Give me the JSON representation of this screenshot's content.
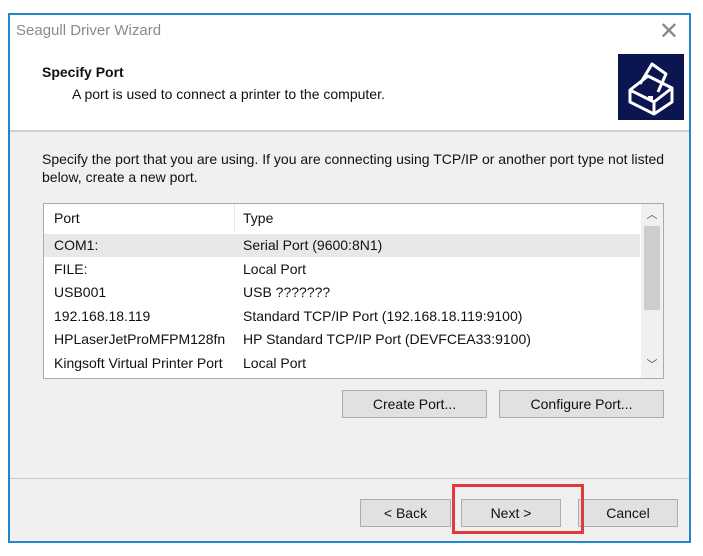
{
  "window": {
    "title": "Seagull Driver Wizard",
    "close": "✕"
  },
  "header": {
    "title": "Specify Port",
    "subtitle": "A port is used to connect a printer to the computer."
  },
  "description": "Specify the port that you are using.  If you are connecting using TCP/IP or another port type not listed below, create a new port.",
  "list": {
    "columns": [
      "Port",
      "Type"
    ],
    "rows": [
      [
        "COM1:",
        "Serial Port (9600:8N1)"
      ],
      [
        "FILE:",
        "Local Port"
      ],
      [
        "USB001",
        "USB ???????"
      ],
      [
        "192.168.18.119",
        "Standard TCP/IP Port (192.168.18.119:9100)"
      ],
      [
        "HPLaserJetProMFPM128fn",
        "HP Standard TCP/IP Port (DEVFCEA33:9100)"
      ],
      [
        "Kingsoft Virtual Printer Port",
        "Local Port"
      ]
    ],
    "selected": 0
  },
  "buttons": {
    "create": "Create Port...",
    "configure": "Configure Port...",
    "back": "< Back",
    "next": "Next >",
    "cancel": "Cancel"
  },
  "colors": {
    "border": "#1e88c8",
    "highlight": "#e03a3a",
    "logo_bg": "#0b1650"
  }
}
